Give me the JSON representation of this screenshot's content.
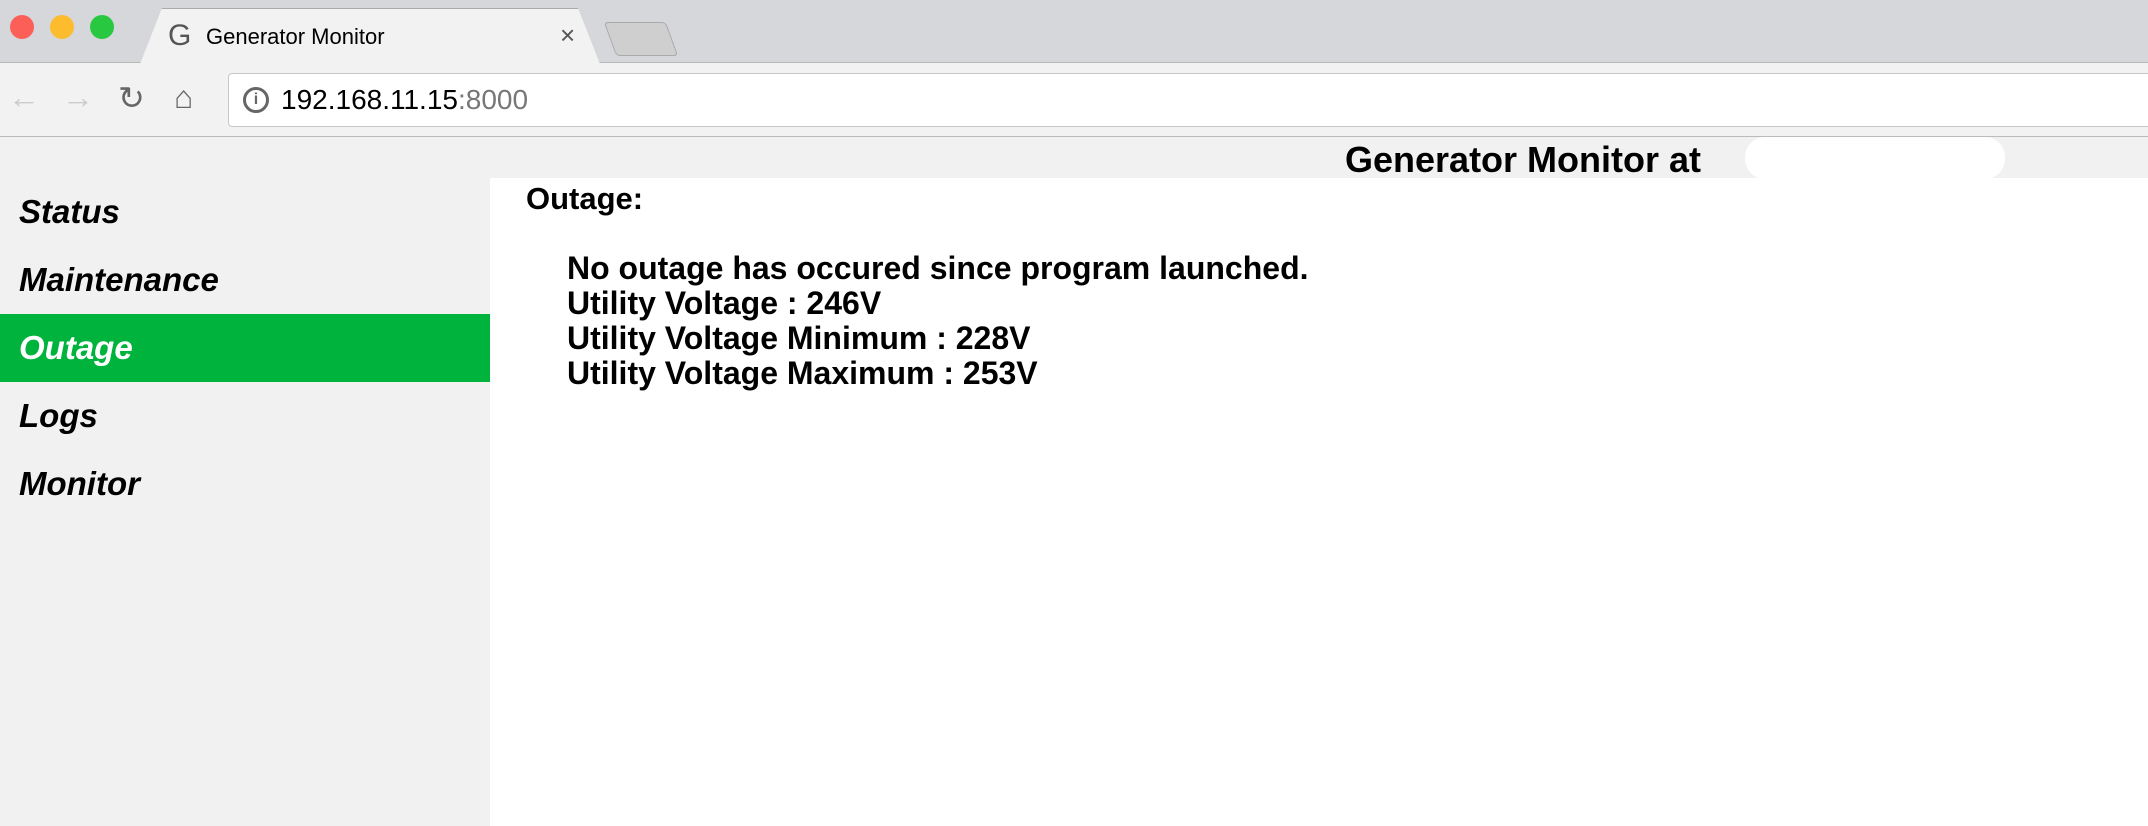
{
  "browser": {
    "tab_title": "Generator Monitor",
    "favicon": "G",
    "url_host": "192.168.11.15",
    "url_port": ":8000"
  },
  "header": {
    "title": "Generator Monitor at"
  },
  "sidebar": {
    "items": [
      {
        "label": "Status",
        "active": false
      },
      {
        "label": "Maintenance",
        "active": false
      },
      {
        "label": "Outage",
        "active": true
      },
      {
        "label": "Logs",
        "active": false
      },
      {
        "label": "Monitor",
        "active": false
      }
    ]
  },
  "main": {
    "heading": "Outage:",
    "lines": [
      "No outage has occured since program launched.",
      "Utility Voltage : 246V",
      "Utility Voltage Minimum : 228V",
      "Utility Voltage Maximum : 253V"
    ]
  },
  "colors": {
    "accent": "#00b33c"
  }
}
